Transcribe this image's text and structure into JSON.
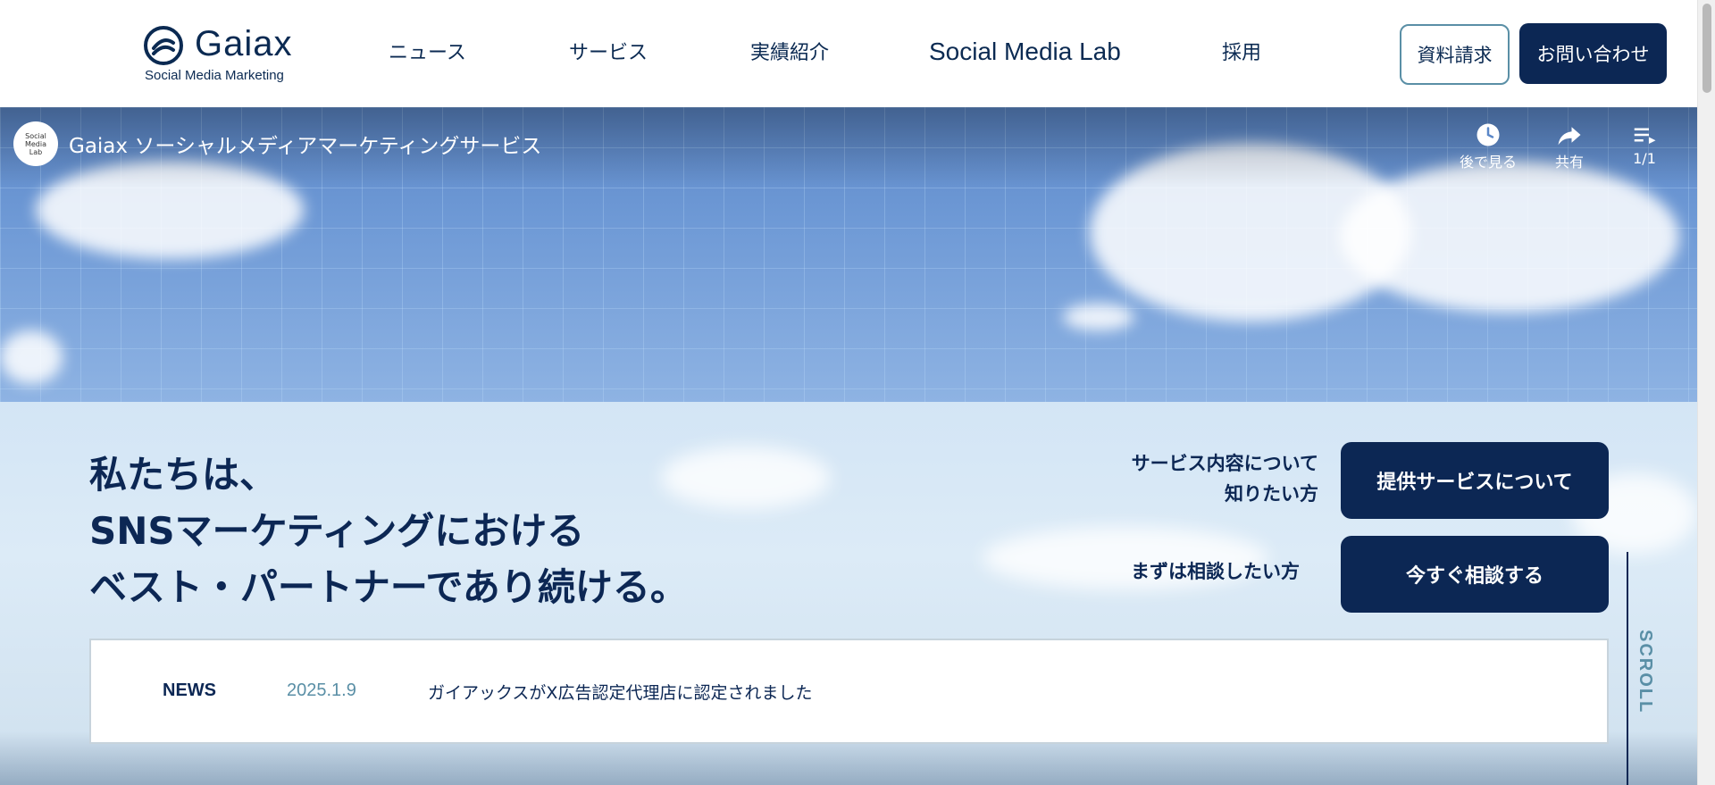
{
  "logo": {
    "word": "Gaiax",
    "sub": "Social Media Marketing"
  },
  "nav": {
    "news": "ニュース",
    "service": "サービス",
    "works": "実績紹介",
    "lab": "Social Media Lab",
    "recruit": "採用"
  },
  "header_buttons": {
    "document": "資料請求",
    "contact": "お問い合わせ"
  },
  "video": {
    "channel_avatar": "Social Media Lab",
    "title": "Gaiax ソーシャルメディアマーケティングサービス",
    "watch_later": "後で見る",
    "share": "共有",
    "playlist_count": "1/1"
  },
  "hero": {
    "headline_lines": [
      "私たちは、",
      "SNSマーケティングにおける",
      "ベスト・パートナーであり続ける。"
    ],
    "cta1_label_line1": "サービス内容について",
    "cta1_label_line2": "知りたい方",
    "cta1_button": "提供サービスについて",
    "cta2_label": "まずは相談したい方",
    "cta2_button": "今すぐ相談する",
    "scroll": "SCROLL"
  },
  "news": {
    "label": "NEWS",
    "date": "2025.1.9",
    "title": "ガイアックスがX広告認定代理店に認定されました"
  },
  "colors": {
    "navy": "#0c2754",
    "teal": "#5a8fa6",
    "sky": "#6f9ad6"
  }
}
